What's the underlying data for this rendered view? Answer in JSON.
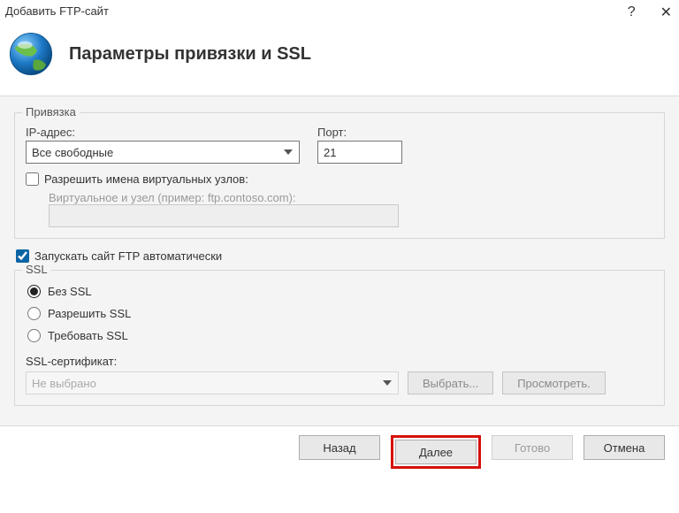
{
  "window": {
    "title": "Добавить FTP-сайт",
    "help_glyph": "?",
    "close_glyph": "✕"
  },
  "header": {
    "page_title": "Параметры привязки и SSL"
  },
  "binding": {
    "legend": "Привязка",
    "ip_label": "IP-адрес:",
    "ip_value": "Все свободные",
    "port_label": "Порт:",
    "port_value": "21",
    "virtual_checkbox_label": "Разрешить имена виртуальных узлов:",
    "virtual_hint": "Виртуальное и узел (пример: ftp.contoso.com):",
    "virtual_value": ""
  },
  "auto_start": {
    "label": "Запускать сайт FTP автоматически"
  },
  "ssl": {
    "legend": "SSL",
    "options": {
      "none": "Без SSL",
      "allow": "Разрешить SSL",
      "require": "Требовать SSL"
    },
    "cert_label": "SSL-сертификат:",
    "cert_value": "Не выбрано",
    "select_btn": "Выбрать...",
    "view_btn": "Просмотреть."
  },
  "footer": {
    "back": "Назад",
    "next": "Далее",
    "finish": "Готово",
    "cancel": "Отмена"
  }
}
